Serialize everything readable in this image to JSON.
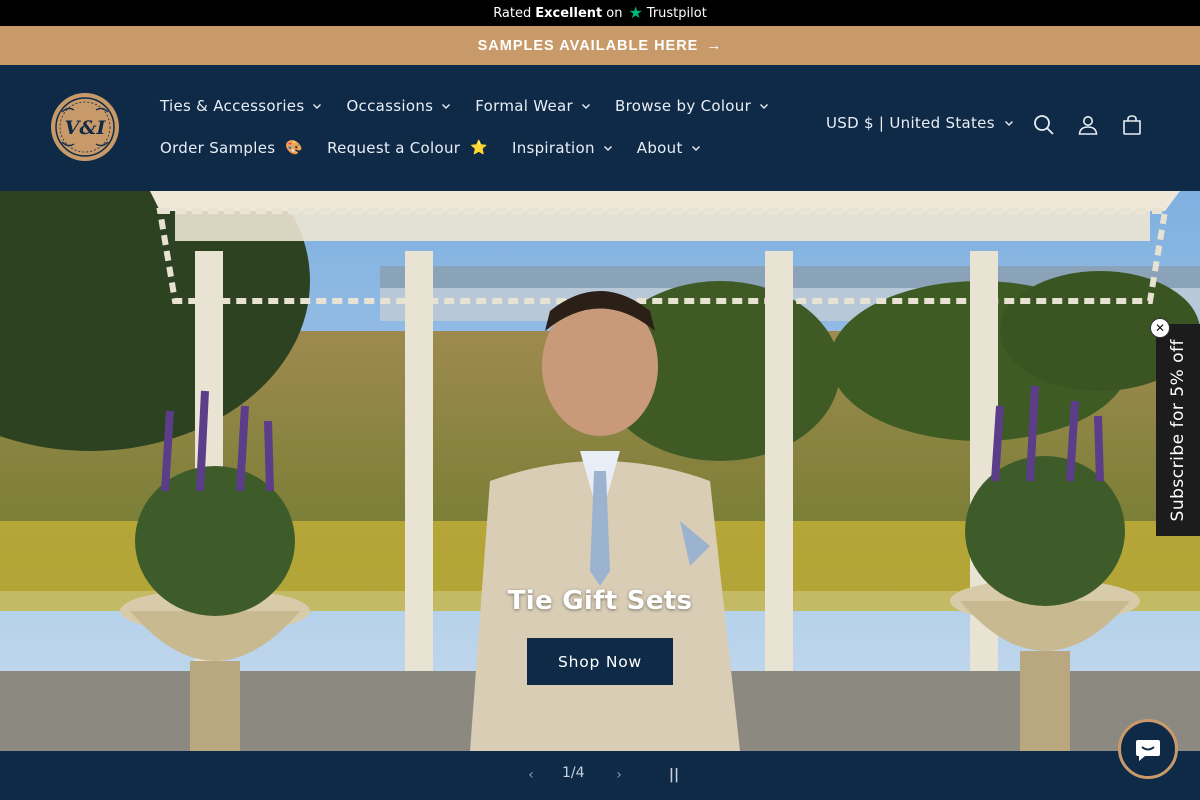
{
  "trustpilot": {
    "rated": "Rated",
    "rating": "Excellent",
    "on": "on",
    "brand": "Trustpilot"
  },
  "announcement": {
    "text": "SAMPLES AVAILABLE HERE",
    "icon": "arrow-right-icon"
  },
  "logo": {
    "text": "V&I"
  },
  "nav": {
    "row1": [
      {
        "label": "Ties & Accessories"
      },
      {
        "label": "Occassions"
      },
      {
        "label": "Formal Wear"
      },
      {
        "label": "Browse by Colour"
      }
    ],
    "row2": [
      {
        "label": "Order Samples",
        "emoji": "🎨"
      },
      {
        "label": "Request a Colour",
        "emoji": "⭐"
      },
      {
        "label": "Inspiration"
      },
      {
        "label": "About"
      }
    ]
  },
  "currency": {
    "label": "USD $ | United States"
  },
  "icons": {
    "search": "search-icon",
    "account": "account-icon",
    "cart": "cart-icon"
  },
  "hero": {
    "title": "Tie Gift Sets",
    "button": "Shop Now"
  },
  "slider": {
    "counter": "1/4",
    "prev": "‹",
    "next": "›",
    "pause": "||"
  },
  "subscribe": {
    "label": "Subscribe for 5% off",
    "close": "✕"
  },
  "colors": {
    "navy": "#0e2a47",
    "tan": "#c99a69",
    "black": "#000000",
    "trustpilot_green": "#00b67a"
  }
}
